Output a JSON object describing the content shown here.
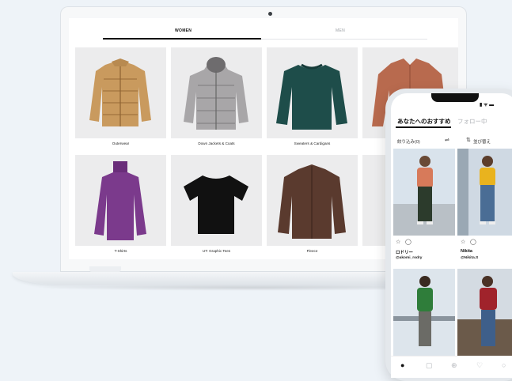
{
  "laptop": {
    "tabs": [
      {
        "label": "WOMEN",
        "active": true
      },
      {
        "label": "MEN",
        "active": false
      }
    ],
    "categories": [
      {
        "label": "Outerwear",
        "item": "tan puffer jacket",
        "color": "#c99a5e"
      },
      {
        "label": "Down Jackets & Coats",
        "item": "grey hooded down jacket",
        "color": "#a8a6a8"
      },
      {
        "label": "Sweaters & Cardigans",
        "item": "dark green sweater",
        "color": "#1e4d4a"
      },
      {
        "label": "",
        "item": "rust shirt",
        "color": "#b86a4e"
      },
      {
        "label": "T-Shirts",
        "item": "purple turtleneck",
        "color": "#7b3a8c"
      },
      {
        "label": "UT: Graphic Tees",
        "item": "black t-shirt",
        "color": "#111111"
      },
      {
        "label": "Fleece",
        "item": "brown fleece jacket",
        "color": "#5a3a2e"
      },
      {
        "label": "",
        "item": "hidden item",
        "color": "#cfd1d4"
      }
    ]
  },
  "phone": {
    "tabs": [
      {
        "label": "あなたへのおすすめ",
        "active": true
      },
      {
        "label": "フォロー中",
        "active": false
      }
    ],
    "filter_label": "絞り込み(0)",
    "sort_label": "並び替え",
    "posts": [
      {
        "name": "ロドリー",
        "handle": "@akomi_rodry",
        "bg": "#d9e3ec",
        "top": "#d77a5a",
        "bottom": "#2c3b2c"
      },
      {
        "name": "Nikita",
        "handle": "@Nikita.S",
        "bg": "#cfd9e3",
        "top": "#e9b31e",
        "bottom": "#4a6d95"
      },
      {
        "name": "",
        "handle": "",
        "bg": "#dde5ec",
        "top": "#2f7d3a",
        "bottom": "#6b6b66"
      },
      {
        "name": "",
        "handle": "",
        "bg": "#d4dbe2",
        "top": "#a0232b",
        "bottom": "#3e5f8a"
      }
    ],
    "icons": {
      "star": "star-icon",
      "comment": "comment-icon"
    },
    "nav": [
      "compass-icon",
      "bag-icon",
      "add-icon",
      "heart-icon",
      "profile-icon"
    ]
  }
}
